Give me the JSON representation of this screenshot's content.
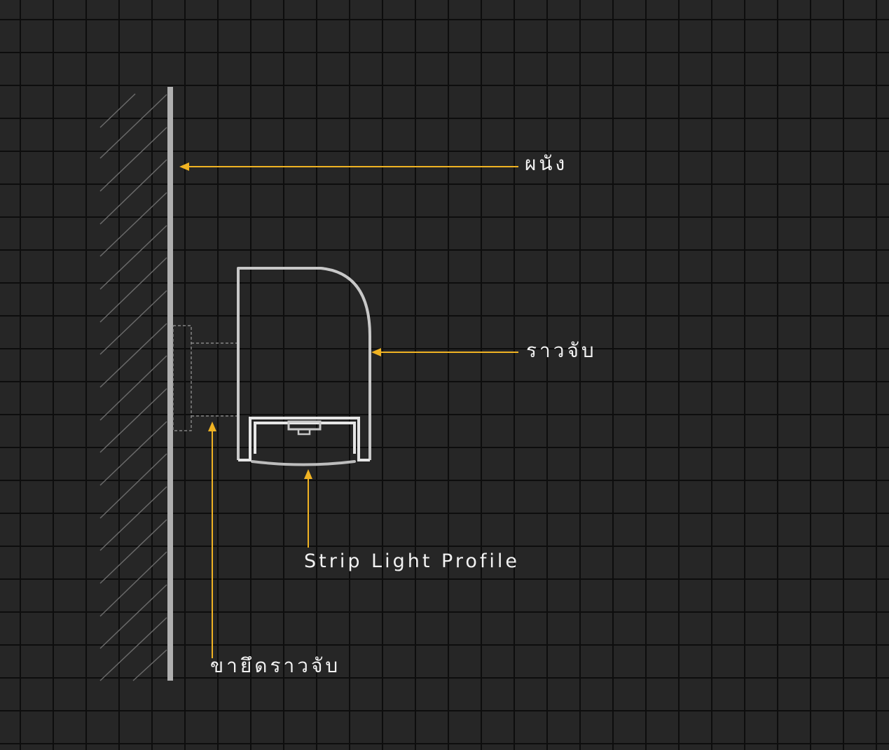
{
  "labels": {
    "wall": "ผนัง",
    "handrail": "ราวจับ",
    "strip_light_profile": "Strip Light Profile",
    "handrail_bracket": "ขายึดราวจับ"
  },
  "colors": {
    "background": "#262626",
    "grid_line": "#0d0d0d",
    "arrow": "#f0b323",
    "profile_stroke": "#c8c8c8",
    "wall_line": "#b0b0b0",
    "hatch": "#6a6a6a",
    "text": "#f2f2f2"
  }
}
